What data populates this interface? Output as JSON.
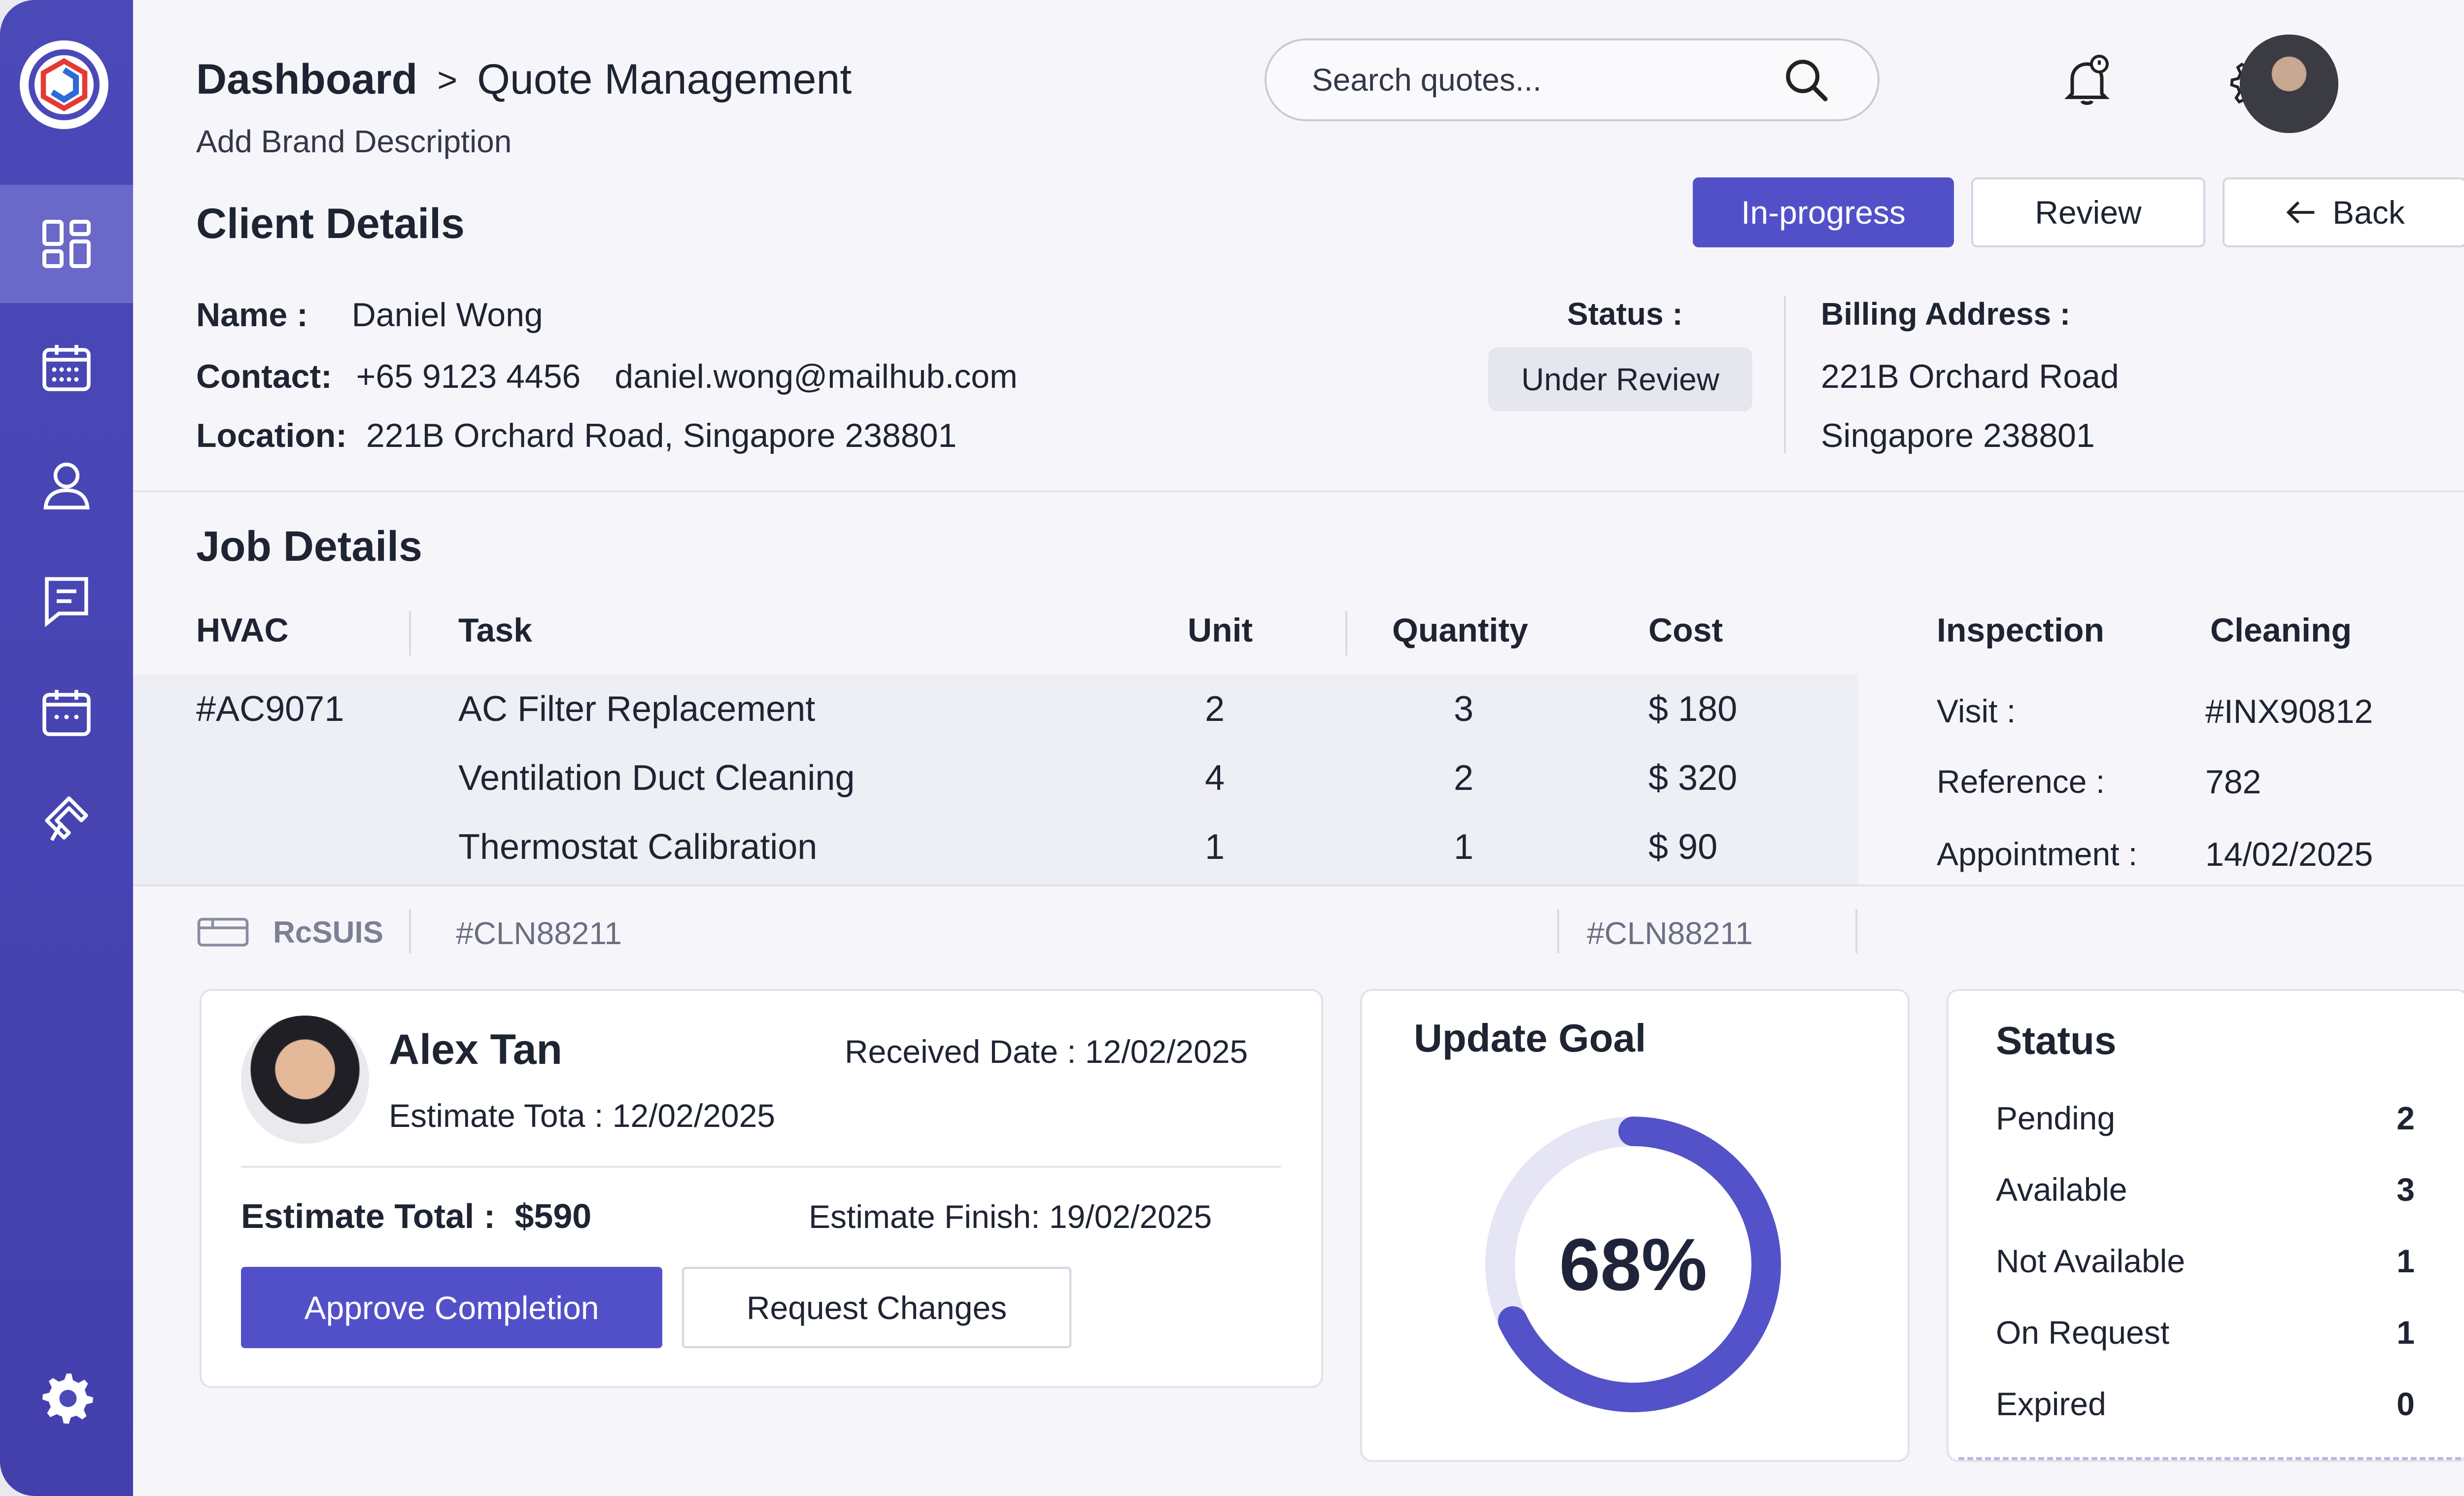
{
  "breadcrumb": {
    "root": "Dashboard",
    "separator": ">",
    "current": "Quote Management"
  },
  "brand_description": "Add Brand Description",
  "search": {
    "placeholder": "Search quotes..."
  },
  "header_actions": {
    "in_progress": "In-progress",
    "review": "Review",
    "back": "Back"
  },
  "client": {
    "heading": "Client Details",
    "name_label": "Name :",
    "name": "Daniel Wong",
    "contact_label": "Contact:",
    "phone": "+65 9123 4456",
    "email": "daniel.wong@mailhub.com",
    "location_label": "Location:",
    "location": "221B Orchard Road, Singapore 238801",
    "status_label": "Status :",
    "status": "Under Review",
    "billing_label": "Billing Address :",
    "billing_line1": "221B Orchard Road",
    "billing_line2": "Singapore 238801"
  },
  "job": {
    "heading": "Job Details",
    "columns": {
      "hvac": "HVAC",
      "task": "Task",
      "unit": "Unit",
      "quantity": "Quantity",
      "cost": "Cost",
      "inspection": "Inspection",
      "cleaning": "Cleaning"
    },
    "hvac_id": "#AC9071",
    "rows": [
      {
        "task": "AC Filter Replacement",
        "unit": "2",
        "quantity": "3",
        "cost": "$ 180"
      },
      {
        "task": "Ventilation Duct Cleaning",
        "unit": "4",
        "quantity": "2",
        "cost": "$ 320"
      },
      {
        "task": "Thermostat Calibration",
        "unit": "1",
        "quantity": "1",
        "cost": "$ 90"
      }
    ],
    "inspection": [
      {
        "label": "Visit :",
        "value": "#INX90812"
      },
      {
        "label": "Reference :",
        "value": "782"
      },
      {
        "label": "Appointment :",
        "value": "14/02/2025"
      }
    ],
    "footer": {
      "tag": "RcSUIS",
      "code1": "#CLN88211",
      "code2": "#CLN88211"
    }
  },
  "estimate": {
    "name": "Alex Tan",
    "received_label": "Received Date :",
    "received": "12/02/2025",
    "estimate_tota_label": "Estimate Tota :",
    "estimate_tota": "12/02/2025",
    "total_label": "Estimate Total :",
    "total": "$590",
    "finish_label": "Estimate Finish:",
    "finish": "19/02/2025",
    "approve": "Approve Completion",
    "request": "Request Changes"
  },
  "goal": {
    "title": "Update Goal",
    "percent_label": "68%",
    "value": 0.68,
    "color": "#5452c8",
    "track": "#e4e3f5"
  },
  "status_panel": {
    "title": "Status",
    "items": [
      {
        "label": "Pending",
        "value": "2"
      },
      {
        "label": "Available",
        "value": "3"
      },
      {
        "label": "Not Available",
        "value": "1"
      },
      {
        "label": "On Request",
        "value": "1"
      },
      {
        "label": "Expired",
        "value": "0"
      }
    ]
  },
  "colors": {
    "accent": "#5250c9",
    "sidebar": "#4b49b8"
  }
}
